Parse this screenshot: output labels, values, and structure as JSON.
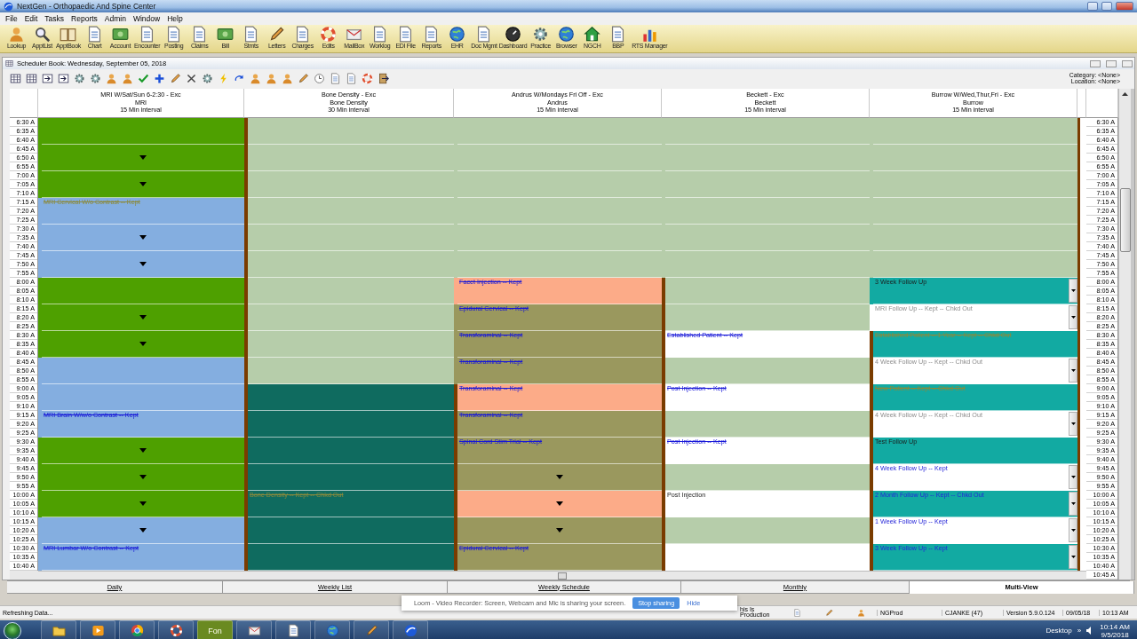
{
  "window": {
    "title": "NextGen - Orthopaedic And Spine Center"
  },
  "menu": [
    "File",
    "Edit",
    "Tasks",
    "Reports",
    "Admin",
    "Window",
    "Help"
  ],
  "toolbar": [
    {
      "label": "Lookup",
      "kind": "person"
    },
    {
      "label": "ApptList",
      "kind": "magnifier"
    },
    {
      "label": "ApptBook",
      "kind": "book"
    },
    {
      "label": "Chart",
      "kind": "doc"
    },
    {
      "label": "Account",
      "kind": "money"
    },
    {
      "label": "Encounter",
      "kind": "doc"
    },
    {
      "label": "Posting",
      "kind": "doc"
    },
    {
      "label": "Claims",
      "kind": "doc"
    },
    {
      "label": "Bill",
      "kind": "money"
    },
    {
      "label": "Stmts",
      "kind": "doc"
    },
    {
      "label": "Letters",
      "kind": "pen"
    },
    {
      "label": "Charges",
      "kind": "doc"
    },
    {
      "label": "Edits",
      "kind": "ring"
    },
    {
      "label": "MailBox",
      "kind": "mail"
    },
    {
      "label": "Worklog",
      "kind": "doc"
    },
    {
      "label": "EDI File",
      "kind": "doc"
    },
    {
      "label": "Reports",
      "kind": "doc"
    },
    {
      "label": "EHR",
      "kind": "globe"
    },
    {
      "label": "Doc Mgmt",
      "kind": "doc"
    },
    {
      "label": "Dashboard",
      "kind": "dial"
    },
    {
      "label": "Practice",
      "kind": "gear"
    },
    {
      "label": "Browser",
      "kind": "globe"
    },
    {
      "label": "NGCH",
      "kind": "house"
    },
    {
      "label": "BBP",
      "kind": "doc"
    },
    {
      "label": "RTS Manager",
      "kind": "chart"
    }
  ],
  "scheduler": {
    "title": "Scheduler Book: Wednesday, September 05, 2018",
    "category": "Category: <None>",
    "location": "Location: <None>",
    "tools": [
      {
        "kind": "grid"
      },
      {
        "kind": "grid"
      },
      {
        "kind": "arrowbox"
      },
      {
        "kind": "arrowbox"
      },
      {
        "kind": "gear"
      },
      {
        "kind": "gear"
      },
      {
        "kind": "person"
      },
      {
        "kind": "person"
      },
      {
        "kind": "check"
      },
      {
        "kind": "plus"
      },
      {
        "kind": "pen"
      },
      {
        "kind": "cross"
      },
      {
        "kind": "gear"
      },
      {
        "kind": "lightning"
      },
      {
        "kind": "redo"
      },
      {
        "kind": "person"
      },
      {
        "kind": "person"
      },
      {
        "kind": "person"
      },
      {
        "kind": "pen"
      },
      {
        "kind": "clock"
      },
      {
        "kind": "doc"
      },
      {
        "kind": "doc"
      },
      {
        "kind": "ring"
      },
      {
        "kind": "exit"
      }
    ],
    "times_left": [
      "6:30 A",
      "6:35 A",
      "6:40 A",
      "6:45 A",
      "6:50 A",
      "6:55 A",
      "7:00 A",
      "7:05 A",
      "7:10 A",
      "7:15 A",
      "7:20 A",
      "7:25 A",
      "7:30 A",
      "7:35 A",
      "7:40 A",
      "7:45 A",
      "7:50 A",
      "7:55 A",
      "8:00 A",
      "8:05 A",
      "8:10 A",
      "8:15 A",
      "8:20 A",
      "8:25 A",
      "8:30 A",
      "8:35 A",
      "8:40 A",
      "8:45 A",
      "8:50 A",
      "8:55 A",
      "9:00 A",
      "9:05 A",
      "9:10 A",
      "9:15 A",
      "9:20 A",
      "9:25 A",
      "9:30 A",
      "9:35 A",
      "9:40 A",
      "9:45 A",
      "9:50 A",
      "9:55 A",
      "10:00 A",
      "10:05 A",
      "10:10 A",
      "10:15 A",
      "10:20 A",
      "10:25 A",
      "10:30 A",
      "10:35 A",
      "10:40 A"
    ],
    "times_right": [
      "6:30 A",
      "6:35 A",
      "6:40 A",
      "6:45 A",
      "6:50 A",
      "6:55 A",
      "7:00 A",
      "7:05 A",
      "7:10 A",
      "7:15 A",
      "7:20 A",
      "7:25 A",
      "7:30 A",
      "7:35 A",
      "7:40 A",
      "7:45 A",
      "7:50 A",
      "7:55 A",
      "8:00 A",
      "8:05 A",
      "8:10 A",
      "8:15 A",
      "8:20 A",
      "8:25 A",
      "8:30 A",
      "8:35 A",
      "8:40 A",
      "8:45 A",
      "8:50 A",
      "8:55 A",
      "9:00 A",
      "9:05 A",
      "9:10 A",
      "9:15 A",
      "9:20 A",
      "9:25 A",
      "9:30 A",
      "9:35 A",
      "9:40 A",
      "9:45 A",
      "9:50 A",
      "9:55 A",
      "10:00 A",
      "10:05 A",
      "10:10 A",
      "10:15 A",
      "10:20 A",
      "10:25 A",
      "10:30 A",
      "10:35 A",
      "10:40 A",
      "10:45 A"
    ],
    "columns": [
      {
        "title": "MRI W/Sat/Sun 6-2:30 - Exc",
        "resource": "MRI",
        "interval": "15 Min interval",
        "slots": [
          {
            "color": "#4ea000",
            "booked": false,
            "arrow": false
          },
          {
            "color": "#4ea000",
            "booked": false,
            "arrow": true
          },
          {
            "color": "#4ea000",
            "booked": false,
            "arrow": true
          },
          {
            "color": "#84aee0",
            "booked": false,
            "arrow": false,
            "text": "MRI Cervical W/o Contrast -- Kept",
            "kind": "faded"
          },
          {
            "color": "#84aee0",
            "booked": false,
            "arrow": true
          },
          {
            "color": "#84aee0",
            "booked": false,
            "arrow": true
          },
          {
            "color": "#4ea000",
            "booked": false,
            "arrow": false
          },
          {
            "color": "#4ea000",
            "booked": false,
            "arrow": true
          },
          {
            "color": "#4ea000",
            "booked": false,
            "arrow": true
          },
          {
            "color": "#84aee0",
            "booked": false,
            "arrow": false
          },
          {
            "color": "#84aee0",
            "booked": false,
            "arrow": false
          },
          {
            "color": "#84aee0",
            "booked": false,
            "arrow": false,
            "text": "MRI Brain W/w/o Contrast -- Kept",
            "kind": "kept"
          },
          {
            "color": "#4ea000",
            "booked": false,
            "arrow": true
          },
          {
            "color": "#4ea000",
            "booked": false,
            "arrow": true
          },
          {
            "color": "#4ea000",
            "booked": false,
            "arrow": true
          },
          {
            "color": "#84aee0",
            "booked": false,
            "arrow": true
          },
          {
            "color": "#84aee0",
            "booked": false,
            "arrow": false,
            "text": "MRI Lumbar W/o Contrast -- Kept",
            "kind": "kept"
          }
        ]
      },
      {
        "title": "Bone Density - Exc",
        "resource": "Bone Density",
        "interval": "30 Min interval",
        "slots": [
          {
            "color": "#b6cdaa",
            "booked": true,
            "arrow": false
          },
          {
            "color": "#b6cdaa",
            "booked": true,
            "arrow": false
          },
          {
            "color": "#b6cdaa",
            "booked": true,
            "arrow": false
          },
          {
            "color": "#b6cdaa",
            "booked": true,
            "arrow": false
          },
          {
            "color": "#b6cdaa",
            "booked": true,
            "arrow": false
          },
          {
            "color": "#b6cdaa",
            "booked": true,
            "arrow": false
          },
          {
            "color": "#b6cdaa",
            "booked": true,
            "arrow": false
          },
          {
            "color": "#b6cdaa",
            "booked": true,
            "arrow": false
          },
          {
            "color": "#b6cdaa",
            "booked": true,
            "arrow": false
          },
          {
            "color": "#b6cdaa",
            "booked": true,
            "arrow": false
          },
          {
            "color": "#0f6b5f",
            "booked": true,
            "arrow": false
          },
          {
            "color": "#0f6b5f",
            "booked": true,
            "arrow": false
          },
          {
            "color": "#0f6b5f",
            "booked": true,
            "arrow": false
          },
          {
            "color": "#0f6b5f",
            "booked": true,
            "arrow": false
          },
          {
            "color": "#0f6b5f",
            "booked": true,
            "arrow": false,
            "text": "Bone Density -- Kept -- Chkd Out",
            "kind": "faded"
          },
          {
            "color": "#0f6b5f",
            "booked": true,
            "arrow": false
          },
          {
            "color": "#0f6b5f",
            "booked": true,
            "arrow": false
          }
        ]
      },
      {
        "title": "Andrus W/Mondays Fri Off - Exc",
        "resource": "Andrus",
        "interval": "15 Min interval",
        "slots": [
          {
            "color": "#b6cdaa",
            "booked": false,
            "arrow": false
          },
          {
            "color": "#b6cdaa",
            "booked": false,
            "arrow": false
          },
          {
            "color": "#b6cdaa",
            "booked": false,
            "arrow": false
          },
          {
            "color": "#b6cdaa",
            "booked": false,
            "arrow": false
          },
          {
            "color": "#b6cdaa",
            "booked": false,
            "arrow": false
          },
          {
            "color": "#b6cdaa",
            "booked": false,
            "arrow": false
          },
          {
            "color": "#fcab88",
            "booked": false,
            "arrow": false,
            "text": "Facet Injection -- Kept",
            "kind": "kept"
          },
          {
            "color": "#9a985e",
            "booked": false,
            "arrow": false,
            "text": "Epidural Cervical -- Kept",
            "kind": "kept"
          },
          {
            "color": "#9a985e",
            "booked": false,
            "arrow": false,
            "text": "Transforaminal -- Kept",
            "kind": "kept"
          },
          {
            "color": "#9a985e",
            "booked": false,
            "arrow": false,
            "text": "Transforaminal -- Kept",
            "kind": "kept"
          },
          {
            "color": "#fcab88",
            "booked": true,
            "arrow": false,
            "text": "Transforaminal -- Kept",
            "kind": "kept"
          },
          {
            "color": "#9a985e",
            "booked": true,
            "arrow": false,
            "text": "Transforaminal -- Kept",
            "kind": "kept"
          },
          {
            "color": "#9a985e",
            "booked": true,
            "arrow": false,
            "text": "Spinal Cord Stim Trial -- Kept",
            "kind": "kept"
          },
          {
            "color": "#9a985e",
            "booked": true,
            "arrow": true
          },
          {
            "color": "#fcab88",
            "booked": true,
            "arrow": true
          },
          {
            "color": "#9a985e",
            "booked": true,
            "arrow": true
          },
          {
            "color": "#9a985e",
            "booked": true,
            "arrow": false,
            "text": "Epidural Cervical -- Kept",
            "kind": "kept"
          }
        ]
      },
      {
        "title": "Beckett - Exc",
        "resource": "Beckett",
        "interval": "15 Min interval",
        "slots": [
          {
            "color": "#b6cdaa",
            "booked": false,
            "arrow": false
          },
          {
            "color": "#b6cdaa",
            "booked": false,
            "arrow": false
          },
          {
            "color": "#b6cdaa",
            "booked": false,
            "arrow": false
          },
          {
            "color": "#b6cdaa",
            "booked": false,
            "arrow": false
          },
          {
            "color": "#b6cdaa",
            "booked": false,
            "arrow": false
          },
          {
            "color": "#b6cdaa",
            "booked": false,
            "arrow": false
          },
          {
            "color": "#b6cdaa",
            "booked": true,
            "arrow": false
          },
          {
            "color": "#b6cdaa",
            "booked": true,
            "arrow": false
          },
          {
            "color": "#ffffff",
            "booked": true,
            "arrow": false,
            "text": "Established Patient -- Kept",
            "kind": "kept"
          },
          {
            "color": "#b6cdaa",
            "booked": true,
            "arrow": false
          },
          {
            "color": "#ffffff",
            "booked": true,
            "arrow": false,
            "text": "Post Injection -- Kept",
            "kind": "kept"
          },
          {
            "color": "#b6cdaa",
            "booked": true,
            "arrow": false
          },
          {
            "color": "#ffffff",
            "booked": true,
            "arrow": false,
            "text": "Post Injection -- Kept",
            "kind": "kept"
          },
          {
            "color": "#b6cdaa",
            "booked": true,
            "arrow": false
          },
          {
            "color": "#ffffff",
            "booked": true,
            "arrow": false,
            "text": "Post Injection",
            "kind": "plain"
          },
          {
            "color": "#b6cdaa",
            "booked": true,
            "arrow": false
          },
          {
            "color": "#ffffff",
            "booked": true,
            "arrow": false
          }
        ]
      },
      {
        "title": "Burrow W/Wed,Thur,Fri - Exc",
        "resource": "Burrow",
        "interval": "15 Min interval",
        "slots": [
          {
            "color": "#b6cdaa",
            "booked": false,
            "arrow": false,
            "dropdown": false
          },
          {
            "color": "#b6cdaa",
            "booked": false,
            "arrow": false,
            "dropdown": false
          },
          {
            "color": "#b6cdaa",
            "booked": false,
            "arrow": false,
            "dropdown": false
          },
          {
            "color": "#b6cdaa",
            "booked": false,
            "arrow": false,
            "dropdown": false
          },
          {
            "color": "#b6cdaa",
            "booked": false,
            "arrow": false,
            "dropdown": false
          },
          {
            "color": "#b6cdaa",
            "booked": false,
            "arrow": false,
            "dropdown": false
          },
          {
            "color": "#12aaa2",
            "booked": false,
            "arrow": false,
            "dropdown": true,
            "text": "3 Week Follow Up",
            "kind": "plain"
          },
          {
            "color": "#ffffff",
            "booked": false,
            "arrow": false,
            "dropdown": true,
            "text": "MRI Follow Up -- Kept -- Chkd Out",
            "kind": "out"
          },
          {
            "color": "#12aaa2",
            "booked": true,
            "arrow": false,
            "dropdown": false,
            "text": "Established Patient -- 1 Year -- Kept -- Chkd Out",
            "kind": "faded"
          },
          {
            "color": "#ffffff",
            "booked": true,
            "arrow": false,
            "dropdown": true,
            "text": "4 Week Follow Up -- Kept -- Chkd Out",
            "kind": "out"
          },
          {
            "color": "#12aaa2",
            "booked": true,
            "arrow": false,
            "dropdown": false,
            "text": "New Patient -- Kept -- Chkd Out",
            "kind": "faded"
          },
          {
            "color": "#ffffff",
            "booked": true,
            "arrow": false,
            "dropdown": true,
            "text": "4 Week Follow Up -- Kept -- Chkd Out",
            "kind": "out"
          },
          {
            "color": "#12aaa2",
            "booked": true,
            "arrow": false,
            "dropdown": false,
            "text": "Test Follow Up",
            "kind": "plain"
          },
          {
            "color": "#ffffff",
            "booked": true,
            "arrow": false,
            "dropdown": true,
            "text": "4 Week Follow Up -- Kept",
            "kind": "link"
          },
          {
            "color": "#12aaa2",
            "booked": true,
            "arrow": false,
            "dropdown": true,
            "text": "2 Month Follow Up -- Kept -- Chkd Out",
            "kind": "link"
          },
          {
            "color": "#ffffff",
            "booked": true,
            "arrow": false,
            "dropdown": true,
            "text": "1 Week Follow Up -- Kept",
            "kind": "link"
          },
          {
            "color": "#12aaa2",
            "booked": true,
            "arrow": false,
            "dropdown": true,
            "text": "3 Week Follow Up -- Kept",
            "kind": "link"
          }
        ]
      }
    ]
  },
  "tabs": [
    {
      "label": "Daily",
      "selected": false
    },
    {
      "label": "Weekly List",
      "selected": false
    },
    {
      "label": "Weekly Schedule",
      "selected": false
    },
    {
      "label": "Monthly",
      "selected": false
    },
    {
      "label": "Multi-View",
      "selected": true
    }
  ],
  "status_bar": {
    "message": "Refreshing Data...",
    "environment": [
      "his Is",
      "Production"
    ],
    "database": "NGProd",
    "user": "CJANKE (47)",
    "version": "Version 5.9.0.124",
    "date": "09/05/18",
    "time": "10:13 AM"
  },
  "share_notice": {
    "message": "Loom - Video Recorder: Screen, Webcam and Mic is sharing your screen.",
    "stop": "Stop sharing",
    "hide": "Hide"
  },
  "taskbar": {
    "apps": [
      {
        "kind": "folder"
      },
      {
        "kind": "play"
      },
      {
        "kind": "wheel"
      },
      {
        "kind": "ring"
      },
      {
        "kind": "text",
        "label": "Fon"
      },
      {
        "kind": "mail"
      },
      {
        "kind": "doc"
      },
      {
        "kind": "globe"
      },
      {
        "kind": "pen"
      },
      {
        "kind": "swirl"
      }
    ],
    "desktop": "Desktop",
    "more": "»",
    "time": "10:14 AM",
    "date": "9/5/2018"
  }
}
